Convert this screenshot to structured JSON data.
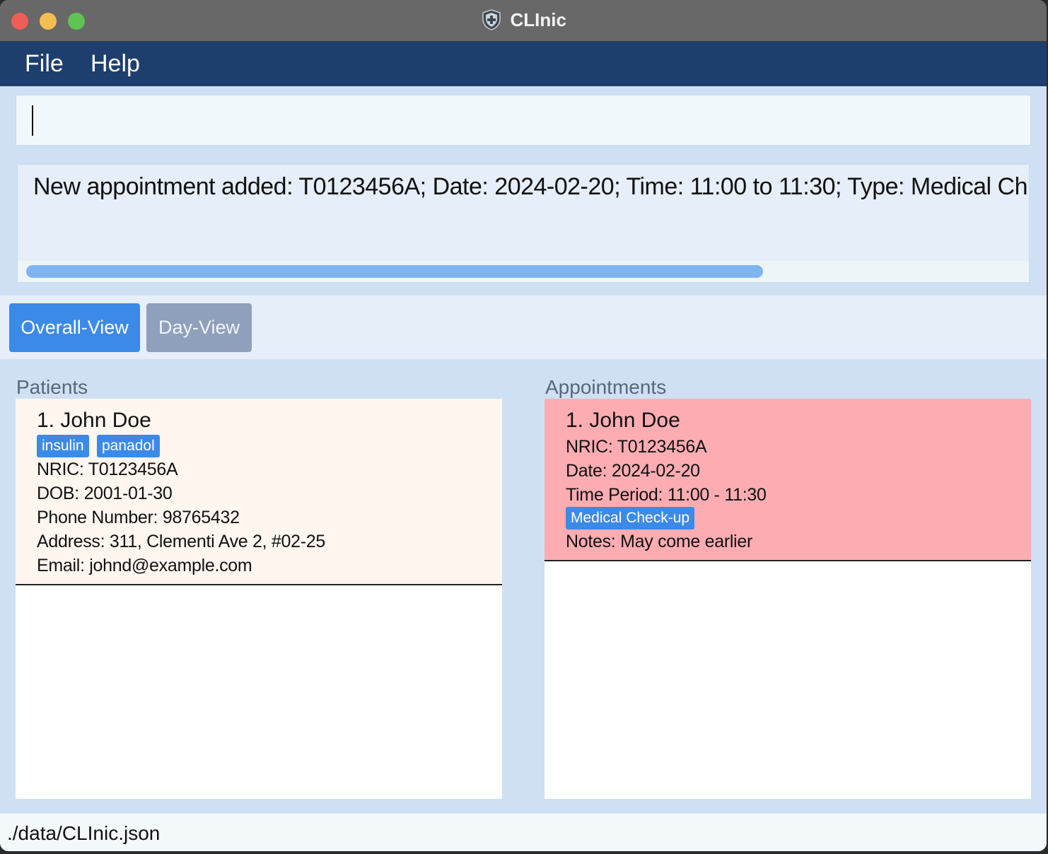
{
  "window": {
    "title": "CLInic"
  },
  "menu": {
    "items": [
      "File",
      "Help"
    ]
  },
  "command": {
    "value": ""
  },
  "result": {
    "text": "New appointment added: T0123456A; Date: 2024-02-20; Time: 11:00 to 11:30; Type: Medical Ch"
  },
  "tabs": [
    {
      "label": "Overall-View",
      "active": true
    },
    {
      "label": "Day-View",
      "active": false
    }
  ],
  "patients": {
    "label": "Patients",
    "items": [
      {
        "title": "1.  John Doe",
        "tags": [
          "insulin",
          "panadol"
        ],
        "nric": "NRIC: T0123456A",
        "dob": "DOB: 2001-01-30",
        "phone": "Phone Number: 98765432",
        "address": "Address: 311, Clementi Ave 2, #02-25",
        "email": "Email: johnd@example.com"
      }
    ]
  },
  "appointments": {
    "label": "Appointments",
    "items": [
      {
        "title": "1.  John Doe",
        "nric": "NRIC: T0123456A",
        "date": "Date: 2024-02-20",
        "time": "Time Period: 11:00 - 11:30",
        "type": "Medical Check-up",
        "notes": "Notes: May come earlier"
      }
    ]
  },
  "status": {
    "path": "./data/CLInic.json"
  },
  "colors": {
    "menubar": "#1e3f6d",
    "accent": "#3b8ae8",
    "appointment_card": "#fdadb2",
    "patient_card": "#fff6f0"
  }
}
